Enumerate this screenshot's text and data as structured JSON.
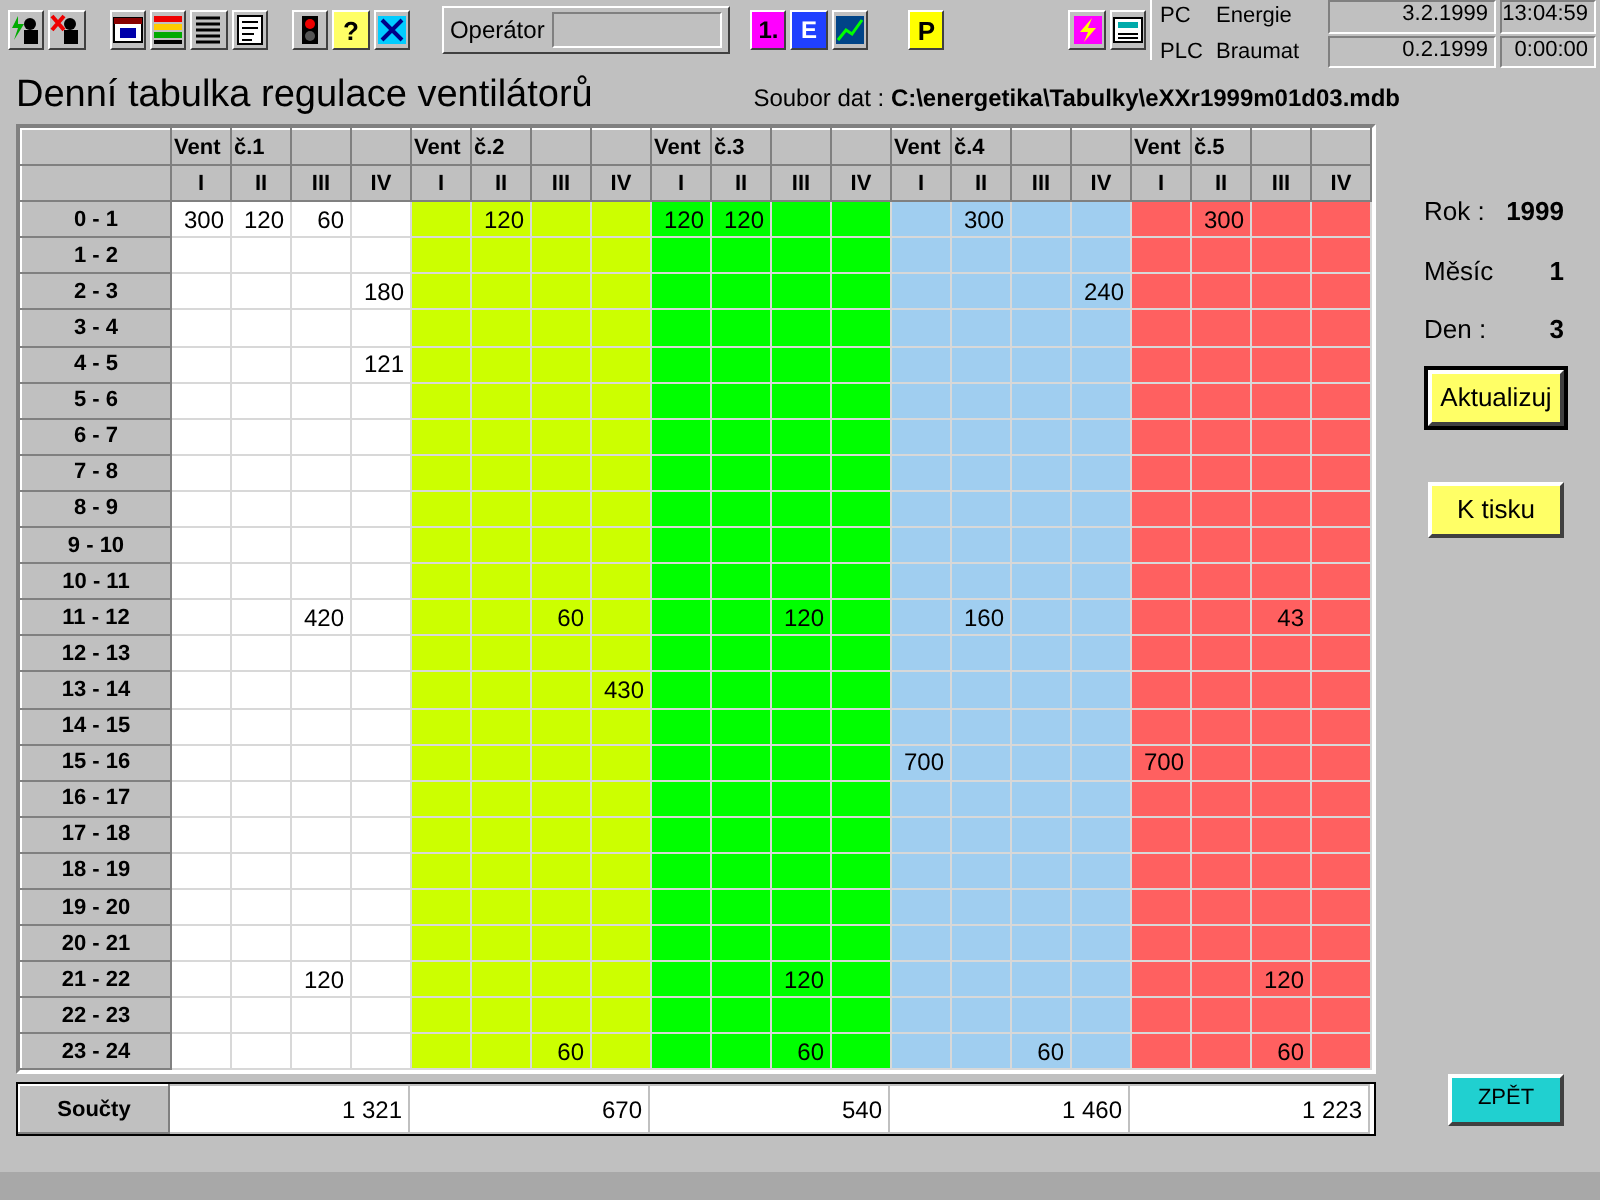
{
  "toolbar": {
    "help_glyph": "?",
    "operator_label": "Operátor",
    "report_glyphs": [
      "1.",
      "E"
    ],
    "p_glyph": "P"
  },
  "status": [
    {
      "name": "PC",
      "label": "Energie",
      "date": "3.2.1999",
      "time": "13:04:59"
    },
    {
      "name": "PLC",
      "label": "Braumat",
      "date": "0.2.1999",
      "time": "0:00:00"
    }
  ],
  "title": "Denní tabulka regulace ventilátorů",
  "file": {
    "label": "Soubor dat :",
    "path": "C:\\energetika\\Tabulky\\eXXr1999m01d03.mdb"
  },
  "table": {
    "groups": [
      {
        "label": "Vent",
        "number": "č.1",
        "color": "#ffffff",
        "columns": [
          "I",
          "II",
          "III",
          "IV"
        ],
        "sum": "1 321"
      },
      {
        "label": "Vent",
        "number": "č.2",
        "color": "#ccff00",
        "columns": [
          "I",
          "II",
          "III",
          "IV"
        ],
        "sum": "670"
      },
      {
        "label": "Vent",
        "number": "č.3",
        "color": "#00ff00",
        "columns": [
          "I",
          "II",
          "III",
          "IV"
        ],
        "sum": "540"
      },
      {
        "label": "Vent",
        "number": "č.4",
        "color": "#a0cef0",
        "columns": [
          "I",
          "II",
          "III",
          "IV"
        ],
        "sum": "1 460"
      },
      {
        "label": "Vent",
        "number": "č.5",
        "color": "#ff6060",
        "columns": [
          "I",
          "II",
          "III",
          "IV"
        ],
        "sum": "1 223"
      }
    ],
    "rows": [
      {
        "hours": "0 - 1",
        "cells": [
          "300",
          "120",
          "60",
          null,
          null,
          "120",
          null,
          null,
          "120",
          "120",
          null,
          null,
          null,
          "300",
          null,
          null,
          null,
          "300",
          null,
          null
        ]
      },
      {
        "hours": "1 - 2",
        "cells": [
          null,
          null,
          null,
          null,
          null,
          null,
          null,
          null,
          null,
          null,
          null,
          null,
          null,
          null,
          null,
          null,
          null,
          null,
          null,
          null
        ]
      },
      {
        "hours": "2 - 3",
        "cells": [
          null,
          null,
          null,
          "180",
          null,
          null,
          null,
          null,
          null,
          null,
          null,
          null,
          null,
          null,
          null,
          "240",
          null,
          null,
          null,
          null
        ]
      },
      {
        "hours": "3 - 4",
        "cells": [
          null,
          null,
          null,
          null,
          null,
          null,
          null,
          null,
          null,
          null,
          null,
          null,
          null,
          null,
          null,
          null,
          null,
          null,
          null,
          null
        ]
      },
      {
        "hours": "4 - 5",
        "cells": [
          null,
          null,
          null,
          "121",
          null,
          null,
          null,
          null,
          null,
          null,
          null,
          null,
          null,
          null,
          null,
          null,
          null,
          null,
          null,
          null
        ]
      },
      {
        "hours": "5 - 6",
        "cells": [
          null,
          null,
          null,
          null,
          null,
          null,
          null,
          null,
          null,
          null,
          null,
          null,
          null,
          null,
          null,
          null,
          null,
          null,
          null,
          null
        ]
      },
      {
        "hours": "6 - 7",
        "cells": [
          null,
          null,
          null,
          null,
          null,
          null,
          null,
          null,
          null,
          null,
          null,
          null,
          null,
          null,
          null,
          null,
          null,
          null,
          null,
          null
        ]
      },
      {
        "hours": "7 - 8",
        "cells": [
          null,
          null,
          null,
          null,
          null,
          null,
          null,
          null,
          null,
          null,
          null,
          null,
          null,
          null,
          null,
          null,
          null,
          null,
          null,
          null
        ]
      },
      {
        "hours": "8 - 9",
        "cells": [
          null,
          null,
          null,
          null,
          null,
          null,
          null,
          null,
          null,
          null,
          null,
          null,
          null,
          null,
          null,
          null,
          null,
          null,
          null,
          null
        ]
      },
      {
        "hours": "9 - 10",
        "cells": [
          null,
          null,
          null,
          null,
          null,
          null,
          null,
          null,
          null,
          null,
          null,
          null,
          null,
          null,
          null,
          null,
          null,
          null,
          null,
          null
        ]
      },
      {
        "hours": "10 - 11",
        "cells": [
          null,
          null,
          null,
          null,
          null,
          null,
          null,
          null,
          null,
          null,
          null,
          null,
          null,
          null,
          null,
          null,
          null,
          null,
          null,
          null
        ]
      },
      {
        "hours": "11 - 12",
        "cells": [
          null,
          null,
          "420",
          null,
          null,
          null,
          "60",
          null,
          null,
          null,
          "120",
          null,
          null,
          "160",
          null,
          null,
          null,
          null,
          "43",
          null
        ]
      },
      {
        "hours": "12 - 13",
        "cells": [
          null,
          null,
          null,
          null,
          null,
          null,
          null,
          null,
          null,
          null,
          null,
          null,
          null,
          null,
          null,
          null,
          null,
          null,
          null,
          null
        ]
      },
      {
        "hours": "13 - 14",
        "cells": [
          null,
          null,
          null,
          null,
          null,
          null,
          null,
          "430",
          null,
          null,
          null,
          null,
          null,
          null,
          null,
          null,
          null,
          null,
          null,
          null
        ]
      },
      {
        "hours": "14 - 15",
        "cells": [
          null,
          null,
          null,
          null,
          null,
          null,
          null,
          null,
          null,
          null,
          null,
          null,
          null,
          null,
          null,
          null,
          null,
          null,
          null,
          null
        ]
      },
      {
        "hours": "15 - 16",
        "cells": [
          null,
          null,
          null,
          null,
          null,
          null,
          null,
          null,
          null,
          null,
          null,
          null,
          "700",
          null,
          null,
          null,
          "700",
          null,
          null,
          null
        ]
      },
      {
        "hours": "16 - 17",
        "cells": [
          null,
          null,
          null,
          null,
          null,
          null,
          null,
          null,
          null,
          null,
          null,
          null,
          null,
          null,
          null,
          null,
          null,
          null,
          null,
          null
        ]
      },
      {
        "hours": "17 - 18",
        "cells": [
          null,
          null,
          null,
          null,
          null,
          null,
          null,
          null,
          null,
          null,
          null,
          null,
          null,
          null,
          null,
          null,
          null,
          null,
          null,
          null
        ]
      },
      {
        "hours": "18 - 19",
        "cells": [
          null,
          null,
          null,
          null,
          null,
          null,
          null,
          null,
          null,
          null,
          null,
          null,
          null,
          null,
          null,
          null,
          null,
          null,
          null,
          null
        ]
      },
      {
        "hours": "19 - 20",
        "cells": [
          null,
          null,
          null,
          null,
          null,
          null,
          null,
          null,
          null,
          null,
          null,
          null,
          null,
          null,
          null,
          null,
          null,
          null,
          null,
          null
        ]
      },
      {
        "hours": "20 - 21",
        "cells": [
          null,
          null,
          null,
          null,
          null,
          null,
          null,
          null,
          null,
          null,
          null,
          null,
          null,
          null,
          null,
          null,
          null,
          null,
          null,
          null
        ]
      },
      {
        "hours": "21 - 22",
        "cells": [
          null,
          null,
          "120",
          null,
          null,
          null,
          null,
          null,
          null,
          null,
          "120",
          null,
          null,
          null,
          null,
          null,
          null,
          null,
          "120",
          null
        ]
      },
      {
        "hours": "22 - 23",
        "cells": [
          null,
          null,
          null,
          null,
          null,
          null,
          null,
          null,
          null,
          null,
          null,
          null,
          null,
          null,
          null,
          null,
          null,
          null,
          null,
          null
        ]
      },
      {
        "hours": "23 - 24",
        "cells": [
          null,
          null,
          null,
          null,
          null,
          null,
          "60",
          null,
          null,
          null,
          "60",
          null,
          null,
          null,
          "60",
          null,
          null,
          null,
          "60",
          null
        ]
      }
    ],
    "sum_label": "Součty"
  },
  "date": [
    {
      "label": "Rok :",
      "value": "1999"
    },
    {
      "label": "Měsíc",
      "value": "1"
    },
    {
      "label": "Den :",
      "value": "3"
    }
  ],
  "buttons": [
    {
      "label": "Aktualizuj",
      "kind": "yellow",
      "focused": true
    },
    {
      "label": "K tisku",
      "kind": "yellow",
      "focused": false
    }
  ],
  "back_button": "ZPĚT"
}
